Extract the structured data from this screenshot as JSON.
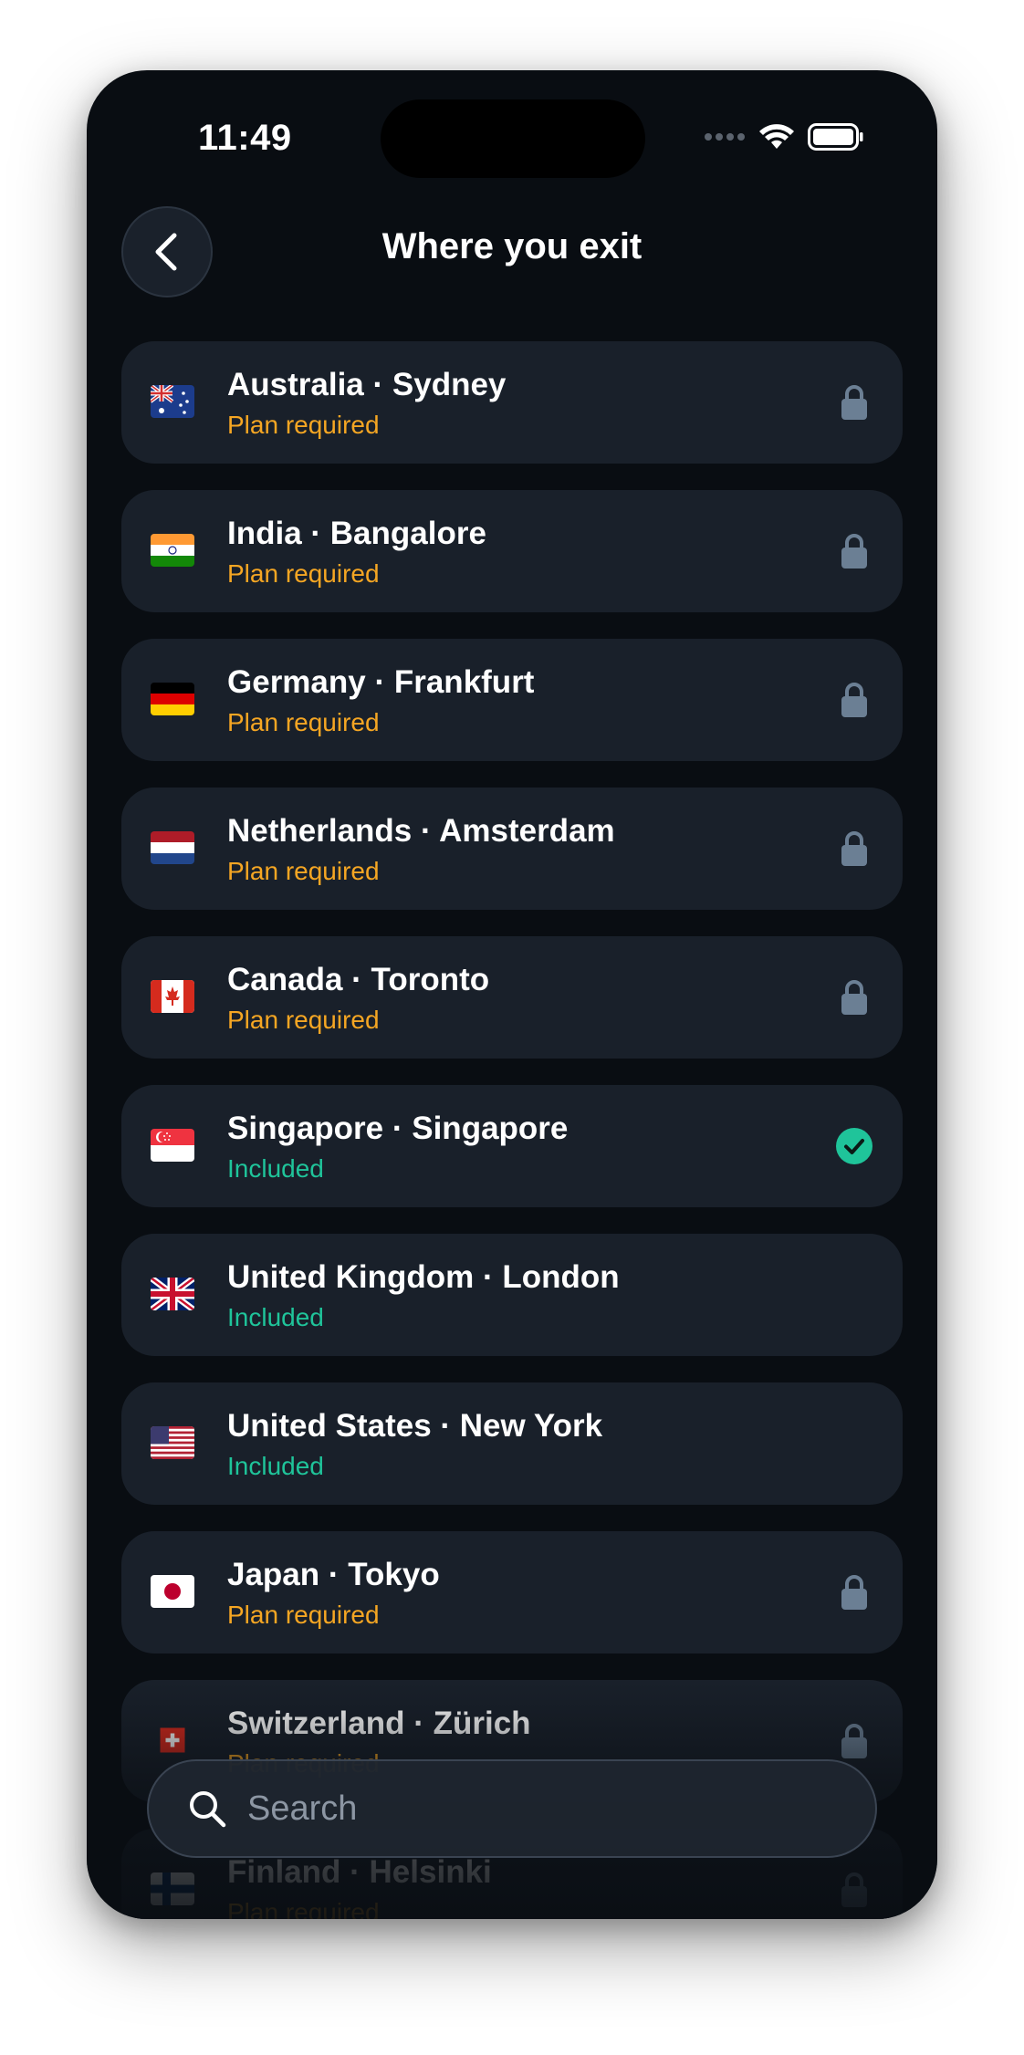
{
  "status": {
    "time": "11:49"
  },
  "header": {
    "title": "Where you exit"
  },
  "colors": {
    "background": "#090d12",
    "card": "#19202a",
    "plan_required": "#f5a623",
    "included": "#1fc49a",
    "lock": "#6b7f94",
    "check": "#1fc49a"
  },
  "locations": [
    {
      "country": "Australia",
      "city": "Sydney",
      "label": "Australia · Sydney",
      "status": "Plan required",
      "icon": "lock-icon",
      "flag": "au"
    },
    {
      "country": "India",
      "city": "Bangalore",
      "label": "India · Bangalore",
      "status": "Plan required",
      "icon": "lock-icon",
      "flag": "in"
    },
    {
      "country": "Germany",
      "city": "Frankfurt",
      "label": "Germany · Frankfurt",
      "status": "Plan required",
      "icon": "lock-icon",
      "flag": "de"
    },
    {
      "country": "Netherlands",
      "city": "Amsterdam",
      "label": "Netherlands · Amsterdam",
      "status": "Plan required",
      "icon": "lock-icon",
      "flag": "nl"
    },
    {
      "country": "Canada",
      "city": "Toronto",
      "label": "Canada · Toronto",
      "status": "Plan required",
      "icon": "lock-icon",
      "flag": "ca"
    },
    {
      "country": "Singapore",
      "city": "Singapore",
      "label": "Singapore · Singapore",
      "status": "Included",
      "icon": "check-icon",
      "flag": "sg"
    },
    {
      "country": "United Kingdom",
      "city": "London",
      "label": "United Kingdom · London",
      "status": "Included",
      "icon": "",
      "flag": "gb"
    },
    {
      "country": "United States",
      "city": "New York",
      "label": "United States · New York",
      "status": "Included",
      "icon": "",
      "flag": "us"
    },
    {
      "country": "Japan",
      "city": "Tokyo",
      "label": "Japan · Tokyo",
      "status": "Plan required",
      "icon": "lock-icon",
      "flag": "jp"
    },
    {
      "country": "Switzerland",
      "city": "Zürich",
      "label": "Switzerland · Zürich",
      "status": "Plan required",
      "icon": "lock-icon",
      "flag": "ch"
    },
    {
      "country": "Finland",
      "city": "Helsinki",
      "label": "Finland · Helsinki",
      "status": "Plan required",
      "icon": "lock-icon",
      "flag": "fi"
    }
  ],
  "search": {
    "placeholder": "Search",
    "value": ""
  }
}
